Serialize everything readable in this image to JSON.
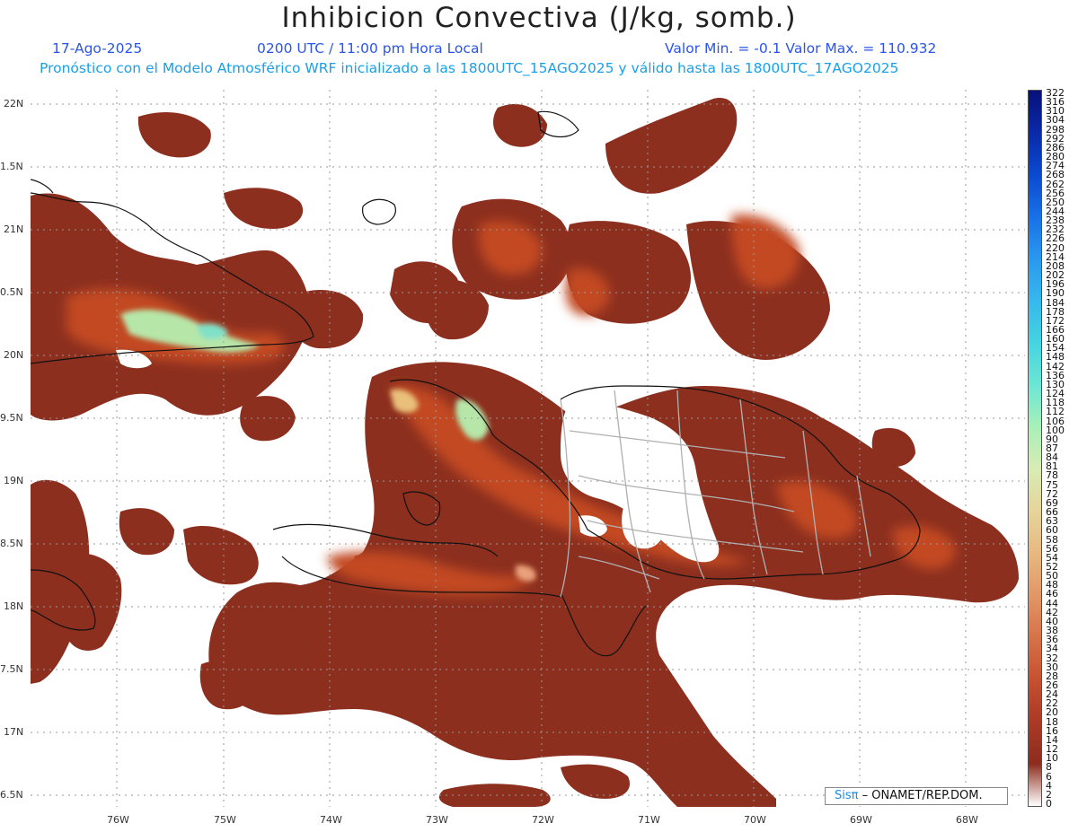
{
  "title": "Inhibicion Convectiva (J/kg, somb.)",
  "header": {
    "date": "17-Ago-2025",
    "time": "0200 UTC / 11:00 pm Hora Local",
    "minmax": "Valor Min. = -0.1  Valor Max. = 110.932",
    "forecast": "Pronóstico con el Modelo Atmosférico WRF inicializado a las 1800UTC_15AGO2025 y válido hasta las  1800UTC_17AGO2025"
  },
  "map": {
    "lat_labels": [
      "22N",
      "1.5N",
      "21N",
      "0.5N",
      "20N",
      "9.5N",
      "19N",
      "8.5N",
      "18N",
      "7.5N",
      "17N",
      "6.5N"
    ],
    "lon_labels": [
      "76W",
      "75W",
      "74W",
      "73W",
      "72W",
      "71W",
      "70W",
      "69W",
      "68W"
    ]
  },
  "colorbar": {
    "labels": [
      "322",
      "316",
      "310",
      "304",
      "298",
      "292",
      "286",
      "280",
      "274",
      "268",
      "262",
      "256",
      "250",
      "244",
      "238",
      "232",
      "226",
      "220",
      "214",
      "208",
      "202",
      "196",
      "190",
      "184",
      "178",
      "172",
      "166",
      "160",
      "154",
      "148",
      "142",
      "136",
      "130",
      "124",
      "118",
      "112",
      "106",
      "100",
      "90",
      "87",
      "84",
      "81",
      "78",
      "75",
      "72",
      "69",
      "66",
      "63",
      "60",
      "58",
      "56",
      "54",
      "52",
      "50",
      "48",
      "46",
      "44",
      "42",
      "40",
      "38",
      "36",
      "34",
      "32",
      "30",
      "28",
      "26",
      "24",
      "22",
      "20",
      "18",
      "16",
      "14",
      "12",
      "10",
      "8",
      "6",
      "4",
      "2",
      "0"
    ]
  },
  "credit": {
    "sispi": "Sisπ",
    "org": "– ONAMET/REP.DOM."
  }
}
